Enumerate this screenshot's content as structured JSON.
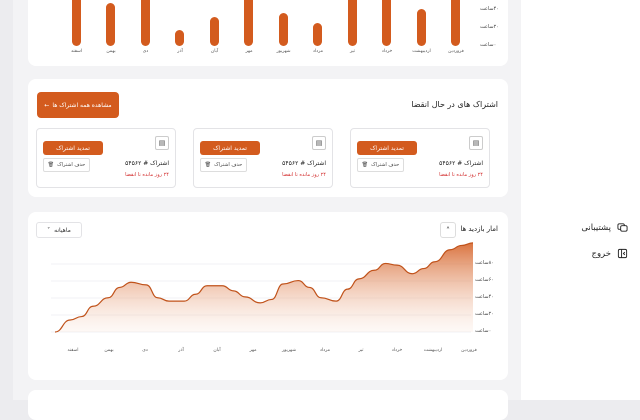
{
  "sidebar": {
    "items": [
      {
        "label": "پشتیبانی",
        "icon": "support-icon"
      },
      {
        "label": "خروج",
        "icon": "logout-icon"
      }
    ]
  },
  "top_chart": {
    "y_ticks": [
      "۴۰ساعت",
      "۲۰ساعت",
      "۰ساعت"
    ],
    "months": [
      "فروردین",
      "اردیبهشت",
      "خرداد",
      "تیر",
      "مرداد",
      "شهریور",
      "مهر",
      "آبان",
      "آذر",
      "دی",
      "بهمن",
      "اسفند"
    ]
  },
  "expiring": {
    "title": "اشتراک های در حال انقضا",
    "view_all_label": "مشاهده همه اشتراک ها",
    "cards": [
      {
        "name": "اشتراک # ۵۴۵۶۲",
        "days": "۲۴ روز مانده تا انقضا",
        "renew": "تمدید اشتراک",
        "delete": "حذف اشتراک"
      },
      {
        "name": "اشتراک # ۵۴۵۶۲",
        "days": "۲۴ روز مانده تا انقضا",
        "renew": "تمدید اشتراک",
        "delete": "حذف اشتراک"
      },
      {
        "name": "اشتراک # ۵۴۵۶۲",
        "days": "۲۴ روز مانده تا انقضا",
        "renew": "تمدید اشتراک",
        "delete": "حذف اشتراک"
      }
    ]
  },
  "visits": {
    "title": "امار بازدید ها",
    "period": "ماهیانه"
  },
  "chart_data": [
    {
      "type": "bar",
      "categories": [
        "فروردین",
        "اردیبهشت",
        "خرداد",
        "تیر",
        "مرداد",
        "شهریور",
        "مهر",
        "آبان",
        "آذر",
        "دی",
        "بهمن",
        "اسفند"
      ],
      "values": [
        42,
        28,
        38,
        42,
        17,
        25,
        45,
        22,
        12,
        45,
        32,
        44
      ],
      "ylim": [
        0,
        45
      ],
      "y_ticks": [
        "۴۰ساعت",
        "۲۰ساعت",
        "۰ساعت"
      ]
    },
    {
      "type": "area",
      "categories": [
        "فروردین",
        "اردیبهشت",
        "خرداد",
        "تیر",
        "مرداد",
        "شهریور",
        "مهر",
        "آبان",
        "آذر",
        "دی",
        "بهمن",
        "اسفند"
      ],
      "y_ticks": [
        "۸۰ساعت",
        "۶۰ساعت",
        "۴۰ساعت",
        "۲۰ساعت",
        "۰ساعت"
      ],
      "x": [
        0,
        0.3,
        0.6,
        1,
        1.3,
        1.6,
        2,
        2.3,
        2.6,
        3,
        3.3,
        3.6,
        4,
        4.3,
        4.6,
        5,
        5.3,
        5.6,
        6,
        6.3,
        6.6,
        7,
        7.3,
        7.6,
        8,
        8.3,
        8.6,
        9,
        9.3,
        9.6,
        10,
        10.3,
        10.6,
        11
      ],
      "values": [
        104,
        101,
        96,
        82,
        74,
        68,
        78,
        80,
        72,
        62,
        50,
        36,
        40,
        52,
        60,
        56,
        38,
        34,
        41,
        48,
        54,
        54,
        44,
        36,
        36,
        40,
        55,
        58,
        52,
        40,
        30,
        18,
        14,
        0
      ],
      "ylim": [
        0,
        105
      ]
    }
  ]
}
